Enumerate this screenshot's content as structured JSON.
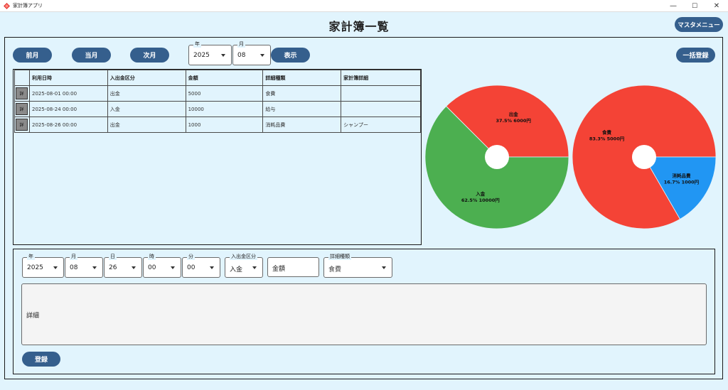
{
  "window": {
    "title": "家計簿アプリ",
    "minimize": "—",
    "maximize": "☐",
    "close": "✕"
  },
  "header": {
    "title": "家計簿一覧",
    "master_menu_label": "マスタメニュー"
  },
  "toolbar": {
    "prev_month": "前月",
    "this_month": "当月",
    "next_month": "次月",
    "year_label": "年",
    "year_value": "2025",
    "month_label": "月",
    "month_value": "08",
    "show_button": "表示",
    "bulk_register": "一括登録"
  },
  "table": {
    "columns": [
      "",
      "利用日時",
      "入出金区分",
      "金額",
      "詳細種類",
      "家計簿詳細"
    ],
    "detail_button_label": "詳",
    "rows": [
      [
        "2025-08-01 00:00",
        "出金",
        "5000",
        "食費",
        ""
      ],
      [
        "2025-08-24 00:00",
        "入金",
        "10000",
        "給与",
        ""
      ],
      [
        "2025-08-26 00:00",
        "出金",
        "1000",
        "消耗品費",
        "シャンプー"
      ]
    ]
  },
  "pies": {
    "left": {
      "slices": [
        {
          "name": "出金",
          "percent": 37.5,
          "value": 6000,
          "text": "37.5% 6000円",
          "color": "#f44336"
        },
        {
          "name": "入金",
          "percent": 62.5,
          "value": 10000,
          "text": "62.5% 10000円",
          "color": "#4caf50"
        }
      ]
    },
    "right": {
      "slices": [
        {
          "name": "食費",
          "percent": 83.3,
          "value": 5000,
          "text": "83.3% 5000円",
          "color": "#f44336"
        },
        {
          "name": "消耗品費",
          "percent": 16.7,
          "value": 1000,
          "text": "16.7% 1000円",
          "color": "#2196f3"
        }
      ]
    }
  },
  "form": {
    "year_label": "年",
    "year_value": "2025",
    "month_label": "月",
    "month_value": "08",
    "day_label": "日",
    "day_value": "26",
    "hour_label": "時",
    "hour_value": "00",
    "minute_label": "分",
    "minute_value": "00",
    "type_label": "入出金区分",
    "type_value": "入金",
    "amount_placeholder": "金額",
    "category_label": "詳細種類",
    "category_value": "食費",
    "detail_placeholder": "詳細",
    "register_button": "登録"
  }
}
